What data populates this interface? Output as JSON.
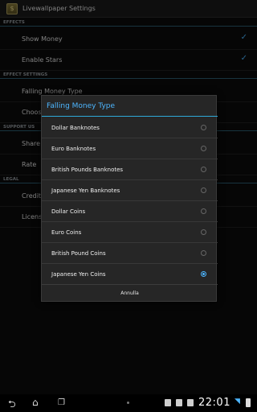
{
  "app": {
    "title": "Livewallpaper Settings",
    "icon": "wallpaper-app-icon"
  },
  "settings": {
    "categories": [
      "EFFECTS",
      "EFFECT SETTINGS",
      "SUPPORT US",
      "LEGAL"
    ],
    "items": [
      {
        "label": "Show Money",
        "checked": true
      },
      {
        "label": "Enable Stars",
        "checked": true
      },
      {
        "label": "Falling Money Type"
      },
      {
        "label": "Choose"
      },
      {
        "label": "Share"
      },
      {
        "label": "Rate"
      },
      {
        "label": "Credits"
      },
      {
        "label": "License"
      }
    ]
  },
  "dialog": {
    "title": "Falling Money Type",
    "options": [
      {
        "label": "Dollar Banknotes",
        "selected": false
      },
      {
        "label": "Euro Banknotes",
        "selected": false
      },
      {
        "label": "British Pounds Banknotes",
        "selected": false
      },
      {
        "label": "Japanese Yen Banknotes",
        "selected": false
      },
      {
        "label": "Dollar Coins",
        "selected": false
      },
      {
        "label": "Euro Coins",
        "selected": false
      },
      {
        "label": "British Pound Coins",
        "selected": false
      },
      {
        "label": "Japanese Yen Coins",
        "selected": true
      }
    ],
    "cancel_label": "Annulla"
  },
  "navbar": {
    "back_icon": "back-icon",
    "home_icon": "home-icon",
    "recents_icon": "recent-apps-icon",
    "time": "22:01"
  },
  "colors": {
    "accent": "#4db6ff",
    "dialog_bg": "#262626",
    "background": "#0b0b0b"
  }
}
